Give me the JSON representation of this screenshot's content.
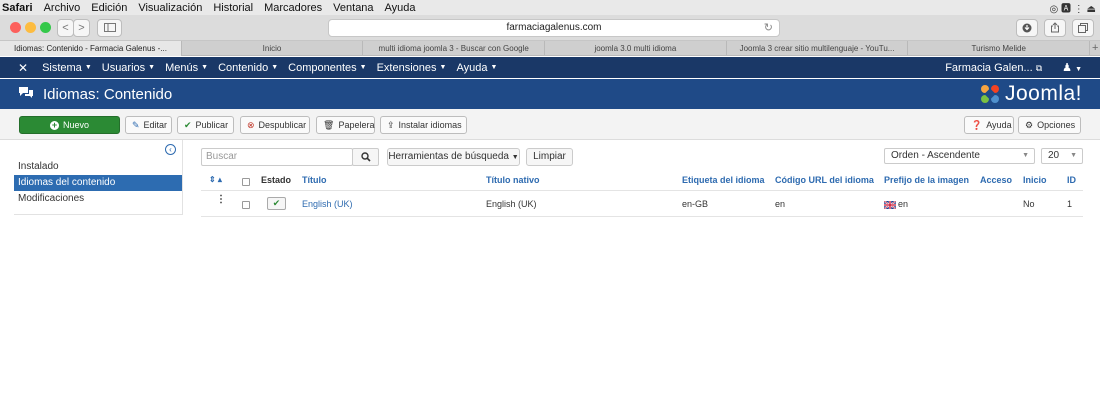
{
  "os_menubar": {
    "items": [
      "Safari",
      "Archivo",
      "Edición",
      "Visualización",
      "Historial",
      "Marcadores",
      "Ventana",
      "Ayuda"
    ],
    "right_text": "◎ 🅰 ⋮ ⏏"
  },
  "browser": {
    "url": "farmaciagalenus.com",
    "back_label": "<",
    "forward_label": ">",
    "tabs": [
      "Idiomas: Contenido - Farmacia Galenus -...",
      "Inicio",
      "multi idioma joomla 3 - Buscar con Google",
      "joomla 3.0 multi idioma",
      "Joomla 3 crear sitio multilenguaje - YouTu...",
      "Turismo Melide"
    ]
  },
  "joomla_nav": {
    "items": [
      "Sistema",
      "Usuarios",
      "Menús",
      "Contenido",
      "Componentes",
      "Extensiones",
      "Ayuda"
    ],
    "site_name": "Farmacia Galen...",
    "external_icon": "⧉",
    "user_icon": "👤"
  },
  "header": {
    "title": "Idiomas: Contenido",
    "logo_text": "Joomla!"
  },
  "toolbar": {
    "new": "Nuevo",
    "edit": "Editar",
    "publish": "Publicar",
    "unpublish": "Despublicar",
    "trash": "Papelera",
    "install": "Instalar idiomas",
    "help": "Ayuda",
    "options": "Opciones"
  },
  "sidebar": {
    "items": [
      {
        "label": "Instalado",
        "active": false
      },
      {
        "label": "Idiomas del contenido",
        "active": true
      },
      {
        "label": "Modificaciones",
        "active": false
      }
    ]
  },
  "filters": {
    "search_placeholder": "Buscar",
    "search_tools": "Herramientas de búsqueda",
    "clear": "Limpiar",
    "ordering": "Orden - Ascendente",
    "limit": "20"
  },
  "table": {
    "columns": {
      "sort": "⇕ ▴",
      "status": "Estado",
      "title": "Título",
      "native_title": "Título nativo",
      "tag": "Etiqueta del idioma",
      "url_code": "Código URL del idioma",
      "image_prefix": "Prefijo de la imagen",
      "access": "Acceso",
      "home": "Inicio",
      "id": "ID"
    },
    "rows": [
      {
        "published": true,
        "title": "English (UK)",
        "native_title": "English (UK)",
        "tag": "en-GB",
        "url_code": "en",
        "image_prefix": "en",
        "access": "",
        "home": "No",
        "id": "1"
      }
    ]
  },
  "colors": {
    "nav_bg": "#1a3867",
    "header_bg": "#1f4a87",
    "link": "#2e6bb0",
    "new_button": "#2b8a34",
    "active_sidebar": "#2d6cb1"
  }
}
